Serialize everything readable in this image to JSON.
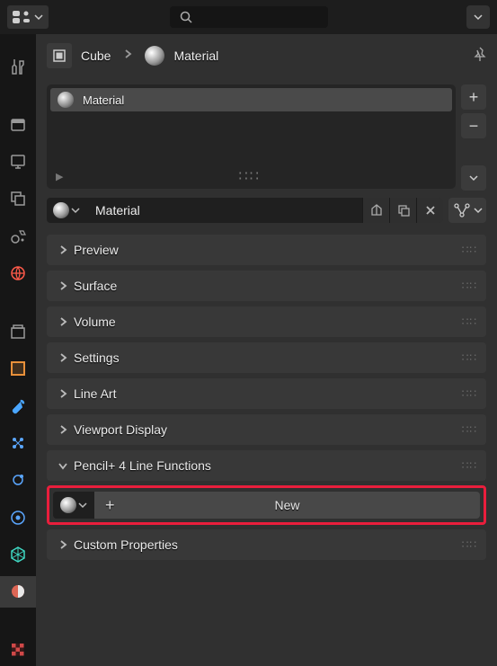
{
  "topbar": {
    "editor_icon": "properties-editor-icon",
    "search_placeholder": ""
  },
  "breadcrumb": {
    "object_name": "Cube",
    "material_name": "Material"
  },
  "material_slots": {
    "items": [
      {
        "name": "Material"
      }
    ]
  },
  "datablock": {
    "name": "Material"
  },
  "panels": {
    "preview": "Preview",
    "surface": "Surface",
    "volume": "Volume",
    "settings": "Settings",
    "lineart": "Line Art",
    "viewport": "Viewport Display",
    "pencil": "Pencil+ 4 Line Functions",
    "custom": "Custom Properties"
  },
  "actions": {
    "new_label": "New"
  },
  "highlight": {
    "target": "new-line-functions-button",
    "color": "#e91e3c"
  }
}
